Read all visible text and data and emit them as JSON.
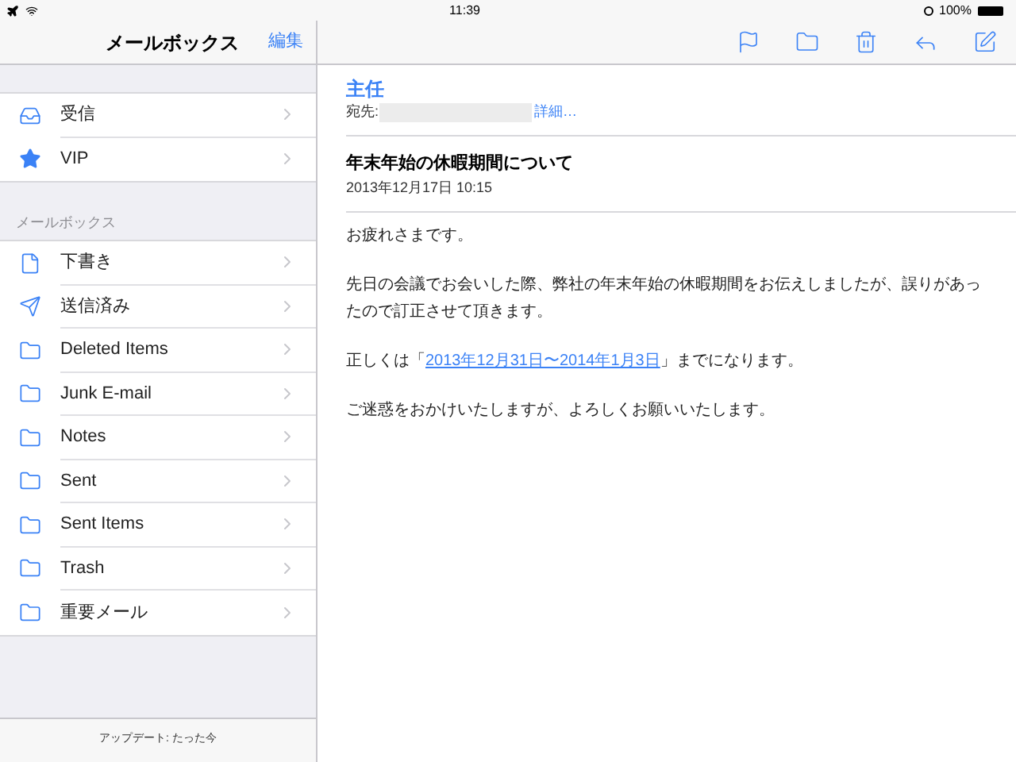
{
  "status_bar": {
    "time": "11:39",
    "battery": "100%"
  },
  "sidebar": {
    "title": "メールボックス",
    "edit_button": "編集",
    "top_items": [
      {
        "label": "受信",
        "kind": "inbox"
      },
      {
        "label": "VIP",
        "kind": "star"
      }
    ],
    "section_header": "メールボックス",
    "items": [
      {
        "label": "下書き",
        "kind": "document"
      },
      {
        "label": "送信済み",
        "kind": "sent"
      },
      {
        "label": "Deleted Items",
        "kind": "folder"
      },
      {
        "label": "Junk E-mail",
        "kind": "folder"
      },
      {
        "label": "Notes",
        "kind": "folder"
      },
      {
        "label": "Sent",
        "kind": "folder"
      },
      {
        "label": "Sent Items",
        "kind": "folder"
      },
      {
        "label": "Trash",
        "kind": "folder"
      },
      {
        "label": "重要メール",
        "kind": "folder"
      }
    ],
    "footer": "アップデート: たった今"
  },
  "message": {
    "sender": "主任",
    "to_label": "宛先:",
    "details_link": "詳細…",
    "subject": "年末年始の休暇期間について",
    "date": "2013年12月17日 10:15",
    "paragraphs": [
      {
        "text": "お疲れさまです。"
      },
      {
        "text": "先日の会議でお会いした際、弊社の年末年始の休暇期間をお伝えしましたが、誤りがあったので訂正させて頂きます。"
      },
      {
        "text": "正しくは「",
        "link": "2013年12月31日〜2014年1月3日",
        "after": "」までになります。"
      },
      {
        "text": "ご迷惑をおかけいたしますが、よろしくお願いいたします。"
      }
    ]
  }
}
